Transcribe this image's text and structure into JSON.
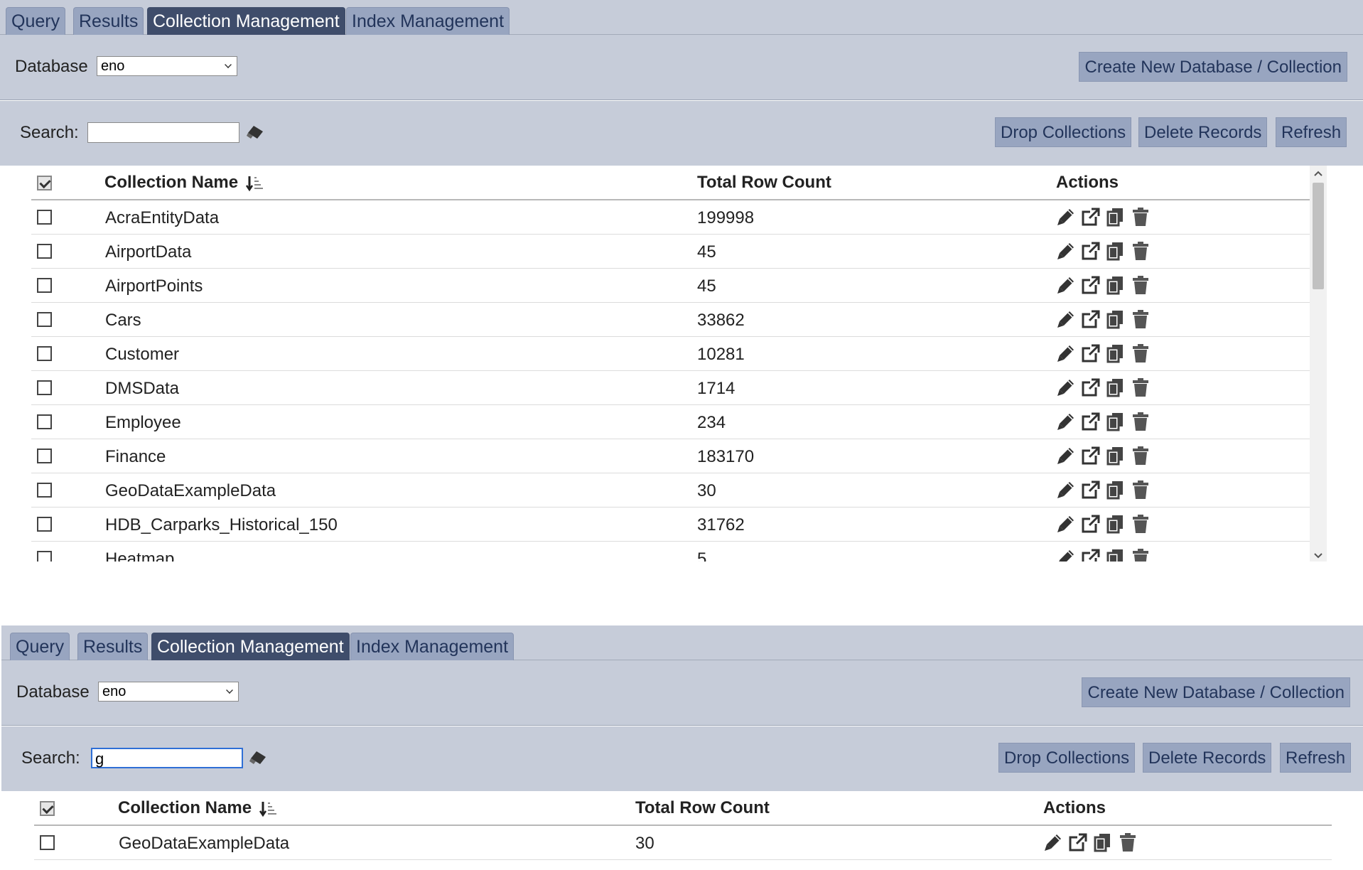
{
  "tabs": [
    "Query",
    "Results",
    "Collection Management",
    "Index Management"
  ],
  "active_tab": "Collection Management",
  "database_label": "Database",
  "database_value": "eno",
  "create_button": "Create New Database / Collection",
  "search_label": "Search:",
  "drop_button": "Drop Collections",
  "delete_button": "Delete Records",
  "refresh_button": "Refresh",
  "columns": {
    "name": "Collection Name",
    "count": "Total Row Count",
    "actions": "Actions"
  },
  "panel1": {
    "search_value": "",
    "rows": [
      {
        "name": "AcraEntityData",
        "count": "199998"
      },
      {
        "name": "AirportData",
        "count": "45"
      },
      {
        "name": "AirportPoints",
        "count": "45"
      },
      {
        "name": "Cars",
        "count": "33862"
      },
      {
        "name": "Customer",
        "count": "10281"
      },
      {
        "name": "DMSData",
        "count": "1714"
      },
      {
        "name": "Employee",
        "count": "234"
      },
      {
        "name": "Finance",
        "count": "183170"
      },
      {
        "name": "GeoDataExampleData",
        "count": "30"
      },
      {
        "name": "HDB_Carparks_Historical_150",
        "count": "31762"
      },
      {
        "name": "Heatmap",
        "count": "5"
      }
    ]
  },
  "panel2": {
    "search_value": "g",
    "rows": [
      {
        "name": "GeoDataExampleData",
        "count": "30"
      }
    ]
  },
  "icons": [
    "pencil-icon",
    "external-link-icon",
    "copy-icon",
    "trash-icon",
    "eraser-icon",
    "sort-desc-icon",
    "chevron-down-icon"
  ]
}
